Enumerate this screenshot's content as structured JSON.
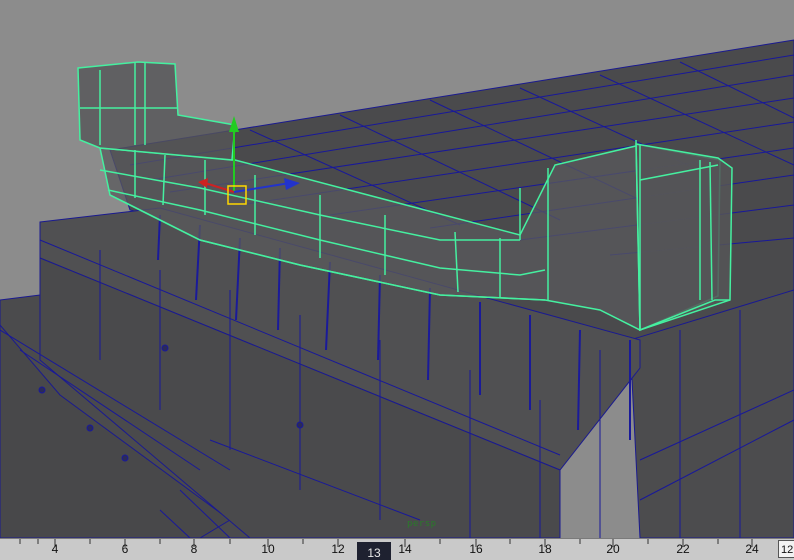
{
  "viewport": {
    "camera_name": "persp",
    "colors": {
      "background": "#8c8c8c",
      "mesh_fill": "#4a4a4c",
      "wire": "#18189a",
      "selected_wire": "#45f0a0",
      "manip_y": "#22cc22",
      "manip_x": "#cc2222",
      "manip_z": "#2233cc",
      "manip_center": "#ffd700"
    },
    "icons": [
      "move-manipulator-icon",
      "axis-y-arrow-icon",
      "axis-x-arrow-icon",
      "axis-z-arrow-icon"
    ]
  },
  "timeline": {
    "ticks": [
      "4",
      "6",
      "8",
      "10",
      "12",
      "14",
      "16",
      "18",
      "20",
      "22",
      "24"
    ],
    "current_frame": "13",
    "current_time_field": "12"
  }
}
